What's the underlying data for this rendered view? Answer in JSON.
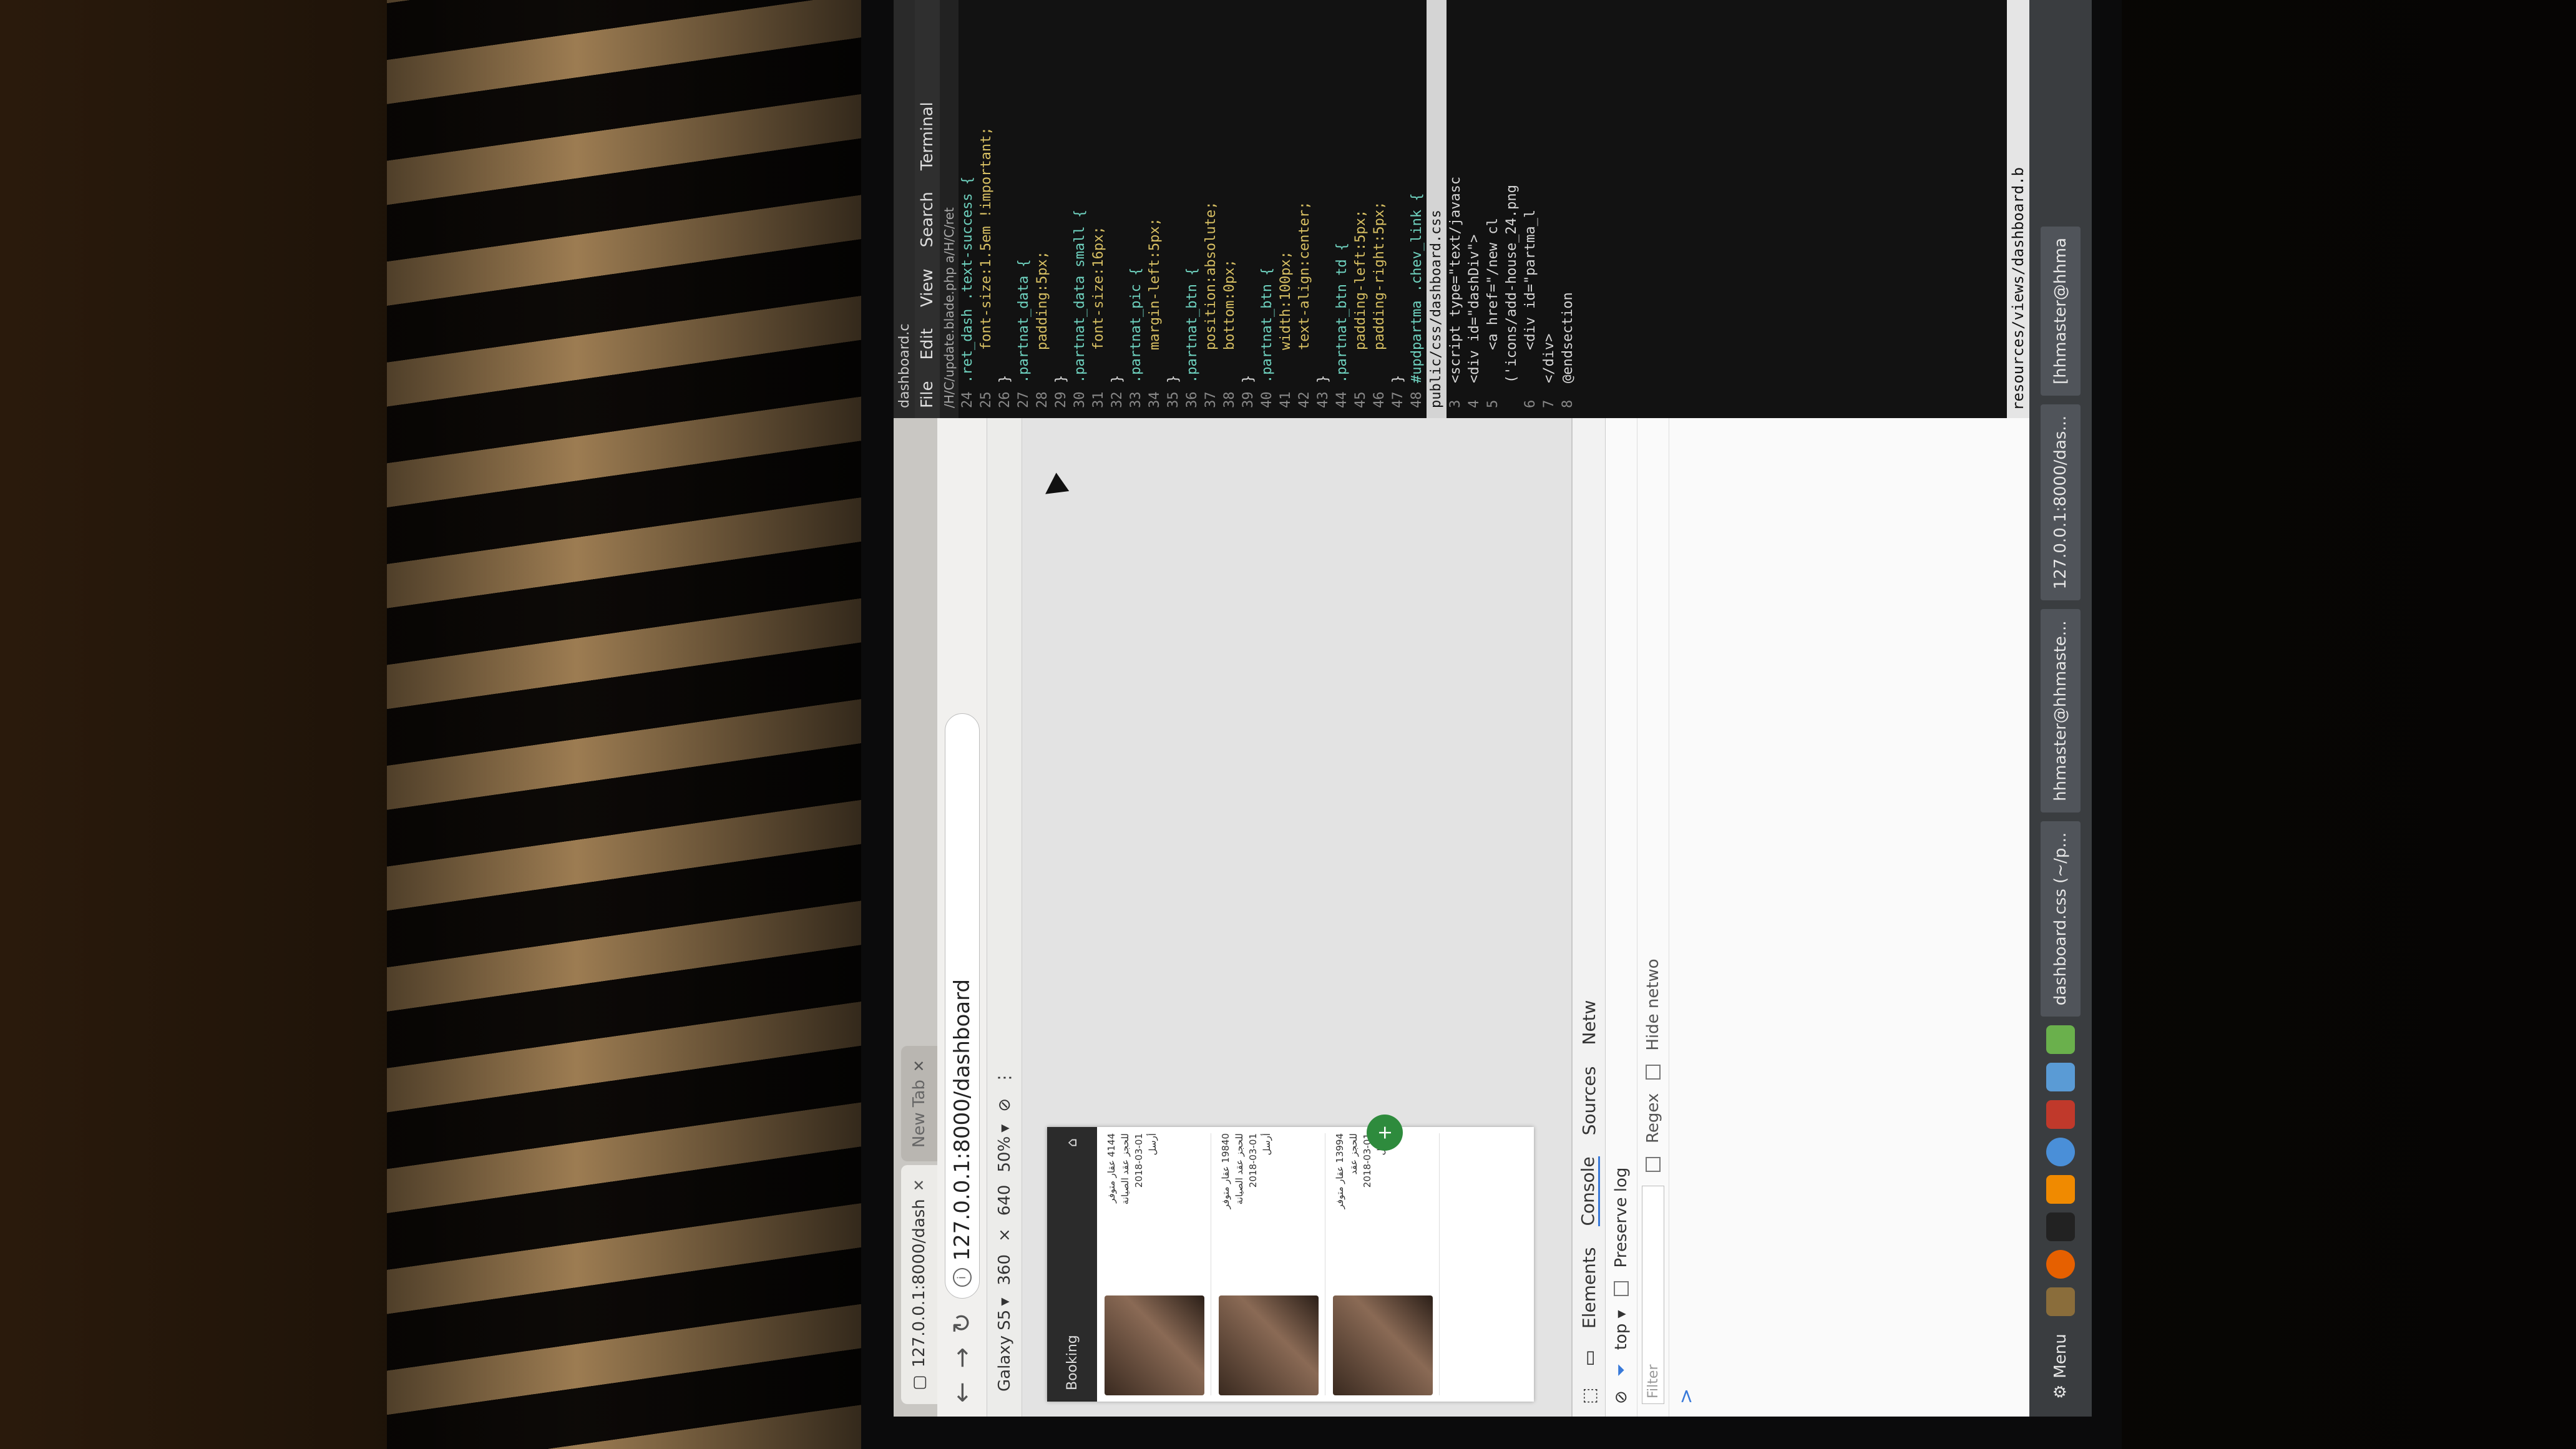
{
  "browser": {
    "tabs": [
      {
        "label": "127.0.0.1:8000/dash"
      },
      {
        "label": "New Tab"
      }
    ],
    "window_title": "127.0.0.1:8000/dashb",
    "url": "127.0.0.1:8000/dashboard",
    "device": {
      "name": "Galaxy S5",
      "width": "360",
      "height": "640",
      "zoom": "50%"
    }
  },
  "phone": {
    "header_title": "Booking",
    "cards": [
      {
        "line1": "4144 عقار متوفر",
        "line2": "للحجز عقد الصيانة",
        "line3": "2018-03-01",
        "line4": "أرسل"
      },
      {
        "line1": "19840 عقار متوفر",
        "line2": "للحجز عقد الصيانة",
        "line3": "2018-03-01",
        "line4": "أرسل"
      },
      {
        "line1": "13994 عقار متوفر",
        "line2": "للحجز عقد",
        "line3": "2018-03-01",
        "line4": "أرسل"
      }
    ]
  },
  "devtools": {
    "tabs": [
      "Elements",
      "Console",
      "Sources",
      "Netw"
    ],
    "active_tab": "Console",
    "context": "top",
    "preserve_log": "Preserve log",
    "filter_placeholder": "Filter",
    "regex": "Regex",
    "hide_network": "Hide netwo",
    "prompt": ">"
  },
  "editor": {
    "title": "dashboard.c",
    "menu": [
      "File",
      "Edit",
      "View",
      "Search",
      "Terminal"
    ],
    "open_file": "/H/C/update.blade.php  a/H/C/ret",
    "css_lines": [
      {
        "n": "24",
        "t": ".ret_dash .text-success {"
      },
      {
        "n": "25",
        "t": "    font-size:1.5em !important;"
      },
      {
        "n": "26",
        "t": "}"
      },
      {
        "n": "27",
        "t": ".partnat_data {"
      },
      {
        "n": "28",
        "t": "    padding:5px;"
      },
      {
        "n": "29",
        "t": "}"
      },
      {
        "n": "30",
        "t": ".partnat_data small {"
      },
      {
        "n": "31",
        "t": "    font-size:16px;"
      },
      {
        "n": "32",
        "t": "}"
      },
      {
        "n": "33",
        "t": ".partnat_pic {"
      },
      {
        "n": "34",
        "t": "    margin-left:5px;"
      },
      {
        "n": "35",
        "t": "}"
      },
      {
        "n": "36",
        "t": ".partnat_btn {"
      },
      {
        "n": "37",
        "t": "    position:absolute;"
      },
      {
        "n": "38",
        "t": "    bottom:0px;"
      },
      {
        "n": "39",
        "t": "}"
      },
      {
        "n": "40",
        "t": ".partnat_btn {"
      },
      {
        "n": "41",
        "t": "    width:100px;"
      },
      {
        "n": "42",
        "t": "    text-align:center;"
      },
      {
        "n": "43",
        "t": "}"
      },
      {
        "n": "44",
        "t": ".partnat_btn td {"
      },
      {
        "n": "45",
        "t": "    padding-left:5px;"
      },
      {
        "n": "46",
        "t": "    padding-right:5px;"
      },
      {
        "n": "47",
        "t": "}"
      },
      {
        "n": "48",
        "t": "#updpartma .chev_link {"
      }
    ],
    "status_file": "public/css/dashboard.css",
    "blade_lines": [
      {
        "n": "3",
        "t": "<script type=\"text/javasc"
      },
      {
        "n": "4",
        "t": "<div id=\"dashDiv\">"
      },
      {
        "n": "5",
        "t": "    <a href=\"/new cl"
      },
      {
        "n": "",
        "t": "('icons/add-house_24.png"
      },
      {
        "n": "6",
        "t": "    <div id=\"partma_l"
      },
      {
        "n": "7",
        "t": "</div>"
      },
      {
        "n": "8",
        "t": "@endsection"
      }
    ],
    "path_footer": "resources/views/dashboard.b"
  },
  "taskbar": {
    "menu_label": "Menu",
    "tasks": [
      {
        "label": "dashboard.css (~/p..."
      },
      {
        "label": "hhmaster@hhmaste..."
      },
      {
        "label": "127.0.0.1:8000/das..."
      },
      {
        "label": "[hhmaster@hhma"
      }
    ]
  }
}
